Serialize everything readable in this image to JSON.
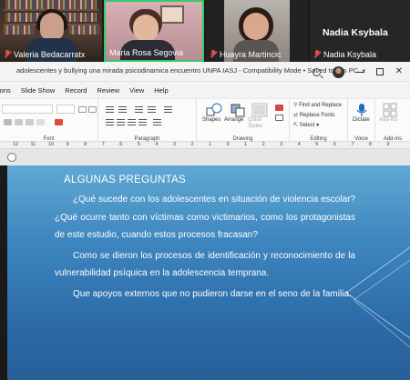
{
  "meeting": {
    "participants": [
      {
        "name": "Valeria Bedacarratx",
        "muted": true
      },
      {
        "name": "Maria Rosa Segovia",
        "muted": false,
        "active": true
      },
      {
        "name": "Huayra Martincic",
        "muted": true
      },
      {
        "name": "Nadia Ksybala",
        "muted": true,
        "video_off": true
      }
    ],
    "big_name": "Nadia Ksybala"
  },
  "window": {
    "title": "adolescentes y bullying una mirada psicodinamica encuentro UNPA IASJ  -  Compatibility Mode  •  Saved to this PC"
  },
  "menu": [
    "ions",
    "Slide Show",
    "Record",
    "Review",
    "View",
    "Help"
  ],
  "ribbon": {
    "groups": {
      "font": "Font",
      "paragraph": "Paragraph",
      "drawing": "Drawing",
      "editing": "Editing",
      "voice": "Voice",
      "addins": "Add-ins"
    },
    "buttons": {
      "shapes": "Shapes",
      "arrange": "Arrange",
      "quick_styles": "Quick Styles",
      "find_replace": "Find and Replace",
      "replace_fonts": "Replace Fonts",
      "select": "Select",
      "dictate": "Dictate",
      "addins": "Add-ins"
    }
  },
  "ruler": [
    "12",
    "11",
    "10",
    "9",
    "8",
    "7",
    "6",
    "5",
    "4",
    "3",
    "2",
    "1",
    "0",
    "1",
    "2",
    "3",
    "4",
    "5",
    "6",
    "7",
    "8",
    "9"
  ],
  "slide": {
    "heading": "ALGUNAS PREGUNTAS",
    "paragraphs": [
      "¿Qué sucede con los adolescentes en situación de violencia escolar? ¿Qué ocurre tanto con víctimas como victimarios, como los protagonistas de este estudio, cuando estos procesos fracasan?",
      "Como se dieron los procesos de  identificación y reconocimiento de la vulnerabilidad psíquica en la adolescencia temprana.",
      "Que apoyos externos que no pudieron darse en el seno de la familia."
    ]
  }
}
